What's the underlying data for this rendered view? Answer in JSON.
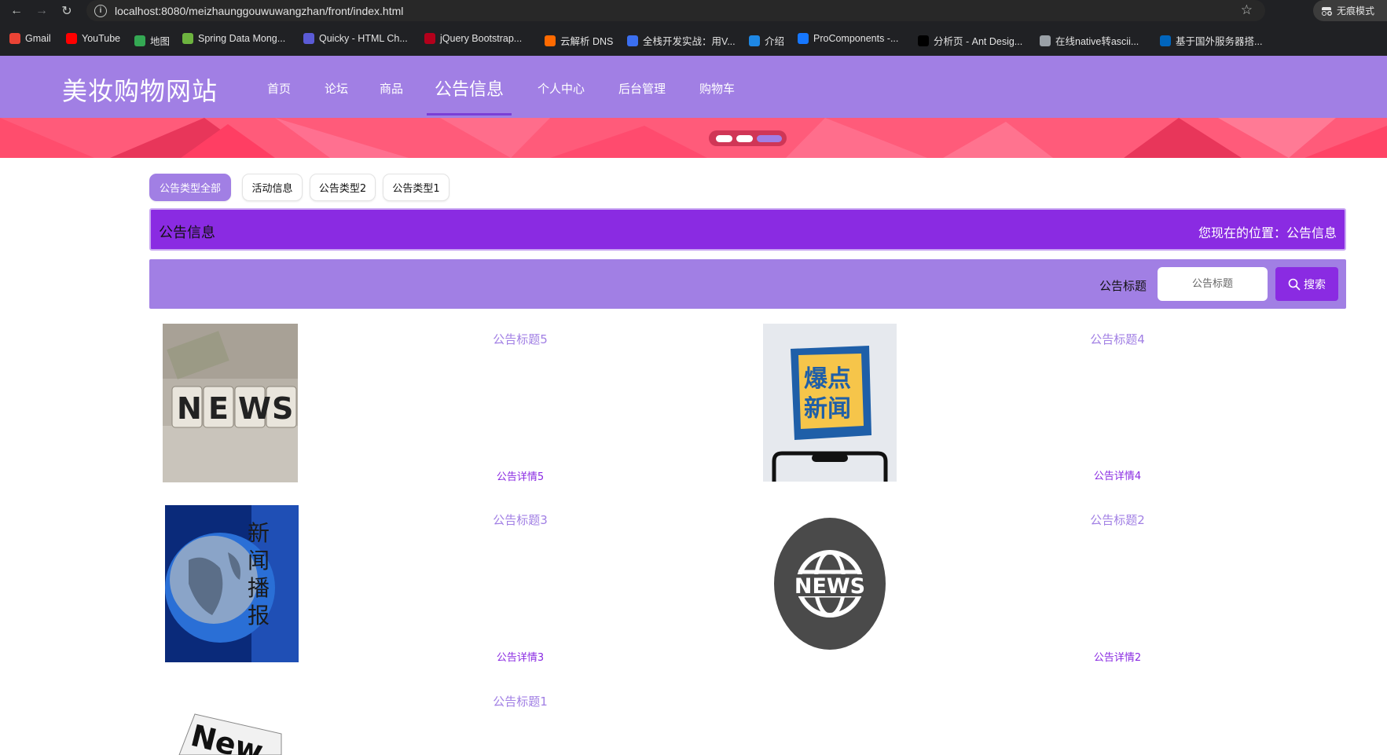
{
  "browser": {
    "url": "localhost:8080/meizhaunggouwuwangzhan/front/index.html",
    "incognito_label": "无痕模式",
    "bookmarks": [
      {
        "label": "Gmail",
        "icon": "gmail-icon",
        "color": "#ea4335"
      },
      {
        "label": "YouTube",
        "icon": "youtube-icon",
        "color": "#ff0000"
      },
      {
        "label": "地图",
        "icon": "maps-icon",
        "color": "#34a853"
      },
      {
        "label": "Spring Data Mong...",
        "icon": "spring-icon",
        "color": "#6db33f"
      },
      {
        "label": "Quicky - HTML Ch...",
        "icon": "quicky-icon",
        "color": "#5b5bd6"
      },
      {
        "label": "jQuery Bootstrap...",
        "icon": "jquery-icon",
        "color": "#b3001b"
      },
      {
        "label": "云解析 DNS",
        "icon": "aliyun-icon",
        "color": "#ff6a00"
      },
      {
        "label": "全栈开发实战：用V...",
        "icon": "m-icon",
        "color": "#3b6ff0"
      },
      {
        "label": "介绍",
        "icon": "intro-icon",
        "color": "#1e88e5"
      },
      {
        "label": "ProComponents -...",
        "icon": "procomponents-icon",
        "color": "#1677ff"
      },
      {
        "label": "分析页 - Ant Desig...",
        "icon": "pro-icon",
        "color": "#000000"
      },
      {
        "label": "在线native转ascii...",
        "icon": "globe-icon",
        "color": "#9aa0a6"
      },
      {
        "label": "基于国外服务器搭...",
        "icon": "scotland-flag-icon",
        "color": "#0065bd"
      }
    ]
  },
  "site": {
    "logo": "美妆购物网站",
    "nav": [
      {
        "label": "首页",
        "active": false
      },
      {
        "label": "论坛",
        "active": false
      },
      {
        "label": "商品",
        "active": false
      },
      {
        "label": "公告信息",
        "active": true
      },
      {
        "label": "个人中心",
        "active": false
      },
      {
        "label": "后台管理",
        "active": false
      },
      {
        "label": "购物车",
        "active": false
      }
    ],
    "accent_color": "#a17fe4",
    "primary_color": "#8a2be2",
    "banner_color": "#ff5b7a"
  },
  "filters": [
    {
      "label": "公告类型全部",
      "active": true
    },
    {
      "label": "活动信息",
      "active": false
    },
    {
      "label": "公告类型2",
      "active": false
    },
    {
      "label": "公告类型1",
      "active": false
    }
  ],
  "title_bar": {
    "title": "公告信息",
    "location": "您现在的位置：公告信息"
  },
  "search": {
    "label": "公告标题",
    "placeholder": "公告标题",
    "button_label": "搜索"
  },
  "notices": [
    {
      "title": "公告标题5",
      "detail": "公告详情5",
      "image": "news-blocks-photo"
    },
    {
      "title": "公告标题4",
      "detail": "公告详情4",
      "image": "baodian-xinwen-phone"
    },
    {
      "title": "公告标题3",
      "detail": "公告详情3",
      "image": "xinwen-bobao-globe"
    },
    {
      "title": "公告标题2",
      "detail": "公告详情2",
      "image": "news-globe-circle-icon"
    },
    {
      "title": "公告标题1",
      "detail": "",
      "image": "news-paper"
    }
  ]
}
